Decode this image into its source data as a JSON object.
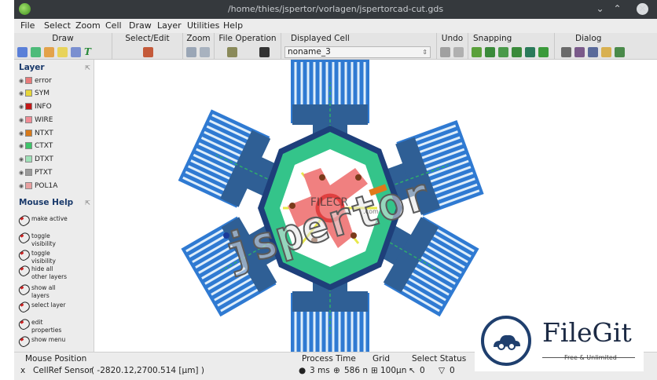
{
  "window": {
    "title": "/home/thies/jspertor/vorlagen/jspertorcad-cut.gds",
    "min_symbol": "⌄",
    "max_symbol": "⌃",
    "close_symbol": "✕"
  },
  "menu": [
    "File",
    "Select",
    "Zoom",
    "Cell",
    "Draw",
    "Layer",
    "Utilities",
    "Help"
  ],
  "toolbar": {
    "groups": [
      "Draw",
      "Select/Edit",
      "Zoom",
      "File Operation",
      "Displayed Cell",
      "Undo",
      "Snapping",
      "Dialog"
    ],
    "displayed_cell": "noname_3",
    "combo_arrow": "⇕"
  },
  "layer_panel": {
    "title": "Layer",
    "layers": [
      {
        "name": "error",
        "color": "#e87a7a"
      },
      {
        "name": "SYM",
        "color": "#e6d63a"
      },
      {
        "name": "INFO",
        "color": "#c41818"
      },
      {
        "name": "WIRE",
        "color": "#f08c95"
      },
      {
        "name": "NTXT",
        "color": "#d87a1a"
      },
      {
        "name": "CTXT",
        "color": "#3ec46a"
      },
      {
        "name": "DTXT",
        "color": "#9fe1b8"
      },
      {
        "name": "PTXT",
        "color": "#9a9a9a"
      },
      {
        "name": "POL1A",
        "color": "#e8a0a0"
      }
    ]
  },
  "mouse_help": {
    "title": "Mouse Help",
    "items": [
      "make active",
      "toggle visibility",
      "toggle visibility",
      "hide all other layers",
      "show all layers",
      "select layer",
      "edit properties",
      "show menu"
    ]
  },
  "canvas": {
    "watermark_text": "jspertor",
    "filecr_text": "FILECR",
    "filecr_domain": ".com"
  },
  "status": {
    "mouse_position_label": "Mouse Position",
    "sensor_label": "CellRef Sensor",
    "coordinates": "( -2820.12,2700.514 [µm] )",
    "process_time_label": "Process Time",
    "process_time": "3 ms",
    "object_count": "586 n",
    "grid_label": "Grid",
    "grid_value": "100µn",
    "select_status_label": "Select Status",
    "selected_count": "0",
    "selected_shape_count": "0"
  },
  "filegit": {
    "name": "FileGit",
    "tagline": "Free & Unlimited"
  }
}
